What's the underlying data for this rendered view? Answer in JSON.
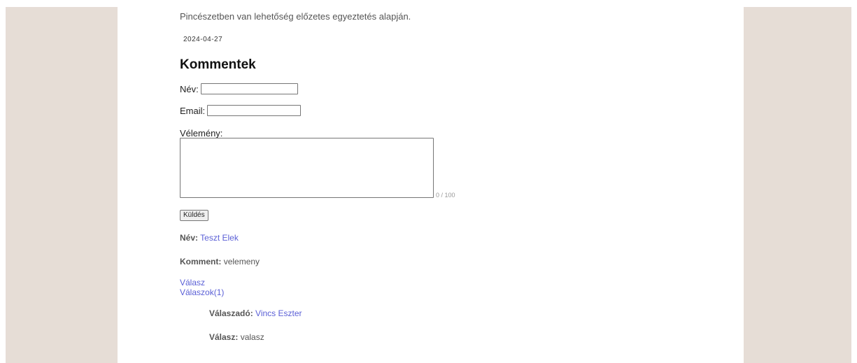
{
  "article": {
    "intro_text": "Pincészetben van lehetőség előzetes egyeztetés alapján.",
    "date": "2024-04-27"
  },
  "comments_section": {
    "heading": "Kommentek",
    "form": {
      "name_label": "Név:",
      "name_value": "",
      "email_label": "Email:",
      "email_value": "",
      "opinion_label": "Vélemény:",
      "opinion_value": "",
      "char_counter": "0 / 100",
      "submit_label": "Küldés"
    },
    "comments": [
      {
        "name_label": "Név:",
        "name": "Teszt Elek",
        "comment_label": "Komment:",
        "comment": "velemeny",
        "reply_link": "Válasz",
        "replies_link": "Válaszok(1)",
        "replies": [
          {
            "replier_label": "Válaszadó:",
            "replier": "Vincs Eszter",
            "reply_label": "Válasz:",
            "reply": "valasz"
          }
        ]
      }
    ]
  },
  "colors": {
    "side_panel": "#e6ddd6",
    "link": "#5a5fd6",
    "text_muted": "#555555"
  }
}
